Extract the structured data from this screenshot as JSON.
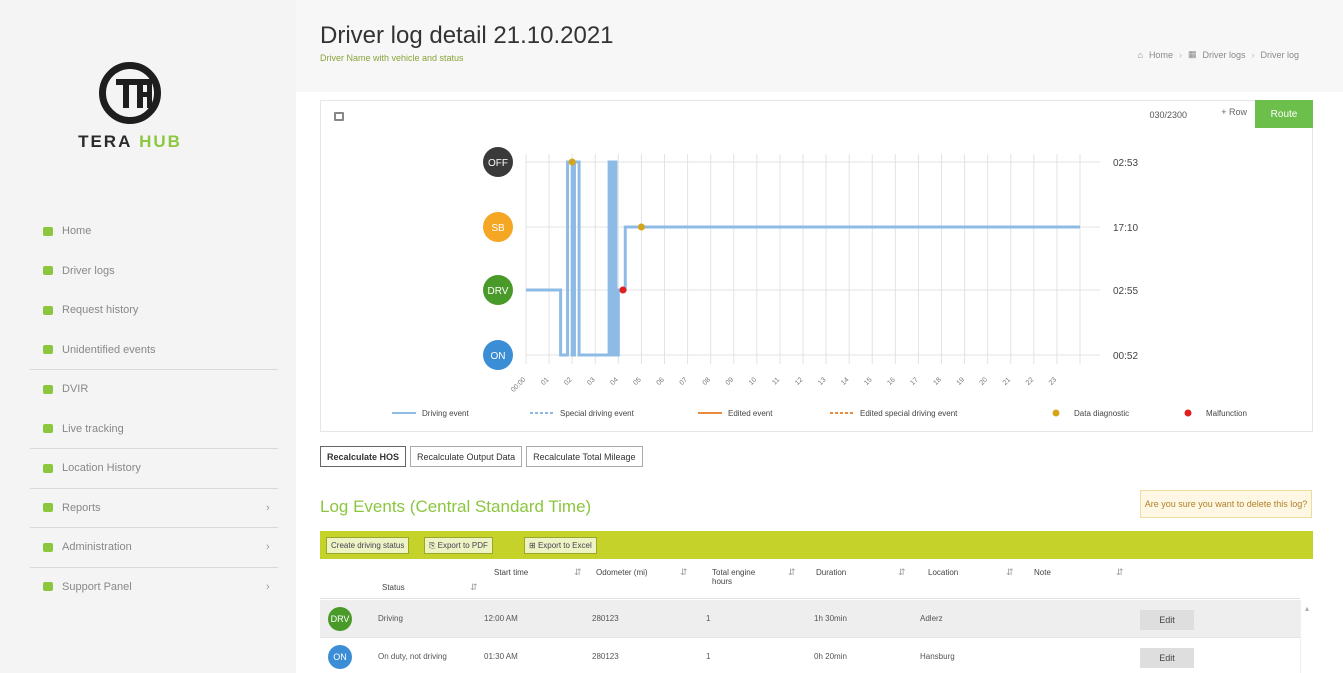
{
  "brand": {
    "part1": "TERA",
    "part2": "HUB"
  },
  "sidebar": {
    "items": [
      {
        "label": "Home",
        "icon": "home-icon",
        "color": "#8cc63f",
        "chevron": ""
      },
      {
        "label": "Driver logs",
        "icon": "edit-icon",
        "color": "#8cc63f",
        "chevron": ""
      },
      {
        "label": "Request history",
        "icon": "history-icon",
        "color": "#8cc63f",
        "chevron": ""
      },
      {
        "label": "Unidentified events",
        "icon": "user-icon",
        "color": "#8cc63f",
        "chevron": ""
      },
      {
        "label": "DVIR",
        "icon": "wrench-icon",
        "color": "#8cc63f",
        "chevron": ""
      },
      {
        "label": "Live tracking",
        "icon": "eye-icon",
        "color": "#8cc63f",
        "chevron": ""
      },
      {
        "label": "Location History",
        "icon": "map-icon",
        "color": "#8cc63f",
        "chevron": ""
      },
      {
        "label": "Reports",
        "icon": "chart-icon",
        "color": "#8cc63f",
        "chevron": "›"
      },
      {
        "label": "Administration",
        "icon": "admin-icon",
        "color": "#8cc63f",
        "chevron": "›"
      },
      {
        "label": "Support Panel",
        "icon": "support-icon",
        "color": "#8cc63f",
        "chevron": "›"
      }
    ]
  },
  "header": {
    "title": "Driver log detail 21.10.2021",
    "subtitle": "Driver Name with vehicle and status",
    "breadcrumb": [
      "Home",
      "Driver logs",
      "Driver log"
    ]
  },
  "chart_panel": {
    "counter": "030/2300",
    "plus_label": "+ Row",
    "action_label": "Route"
  },
  "chart_data": {
    "type": "line",
    "status_labels": [
      "OFF",
      "SB",
      "DRV",
      "ON"
    ],
    "status_colors": [
      "#3a3a3a",
      "#f5a623",
      "#4a9a2a",
      "#3b8ed6"
    ],
    "totals": [
      "02:53",
      "17:10",
      "02:55",
      "00:52"
    ],
    "x_ticks": [
      "00:00",
      "01",
      "02",
      "03",
      "04",
      "05",
      "06",
      "07",
      "08",
      "09",
      "10",
      "11",
      "12",
      "13",
      "14",
      "15",
      "16",
      "17",
      "18",
      "19",
      "20",
      "21",
      "22",
      "23"
    ],
    "legend": [
      {
        "label": "Driving event",
        "style": "solid",
        "color": "#8ebbe6"
      },
      {
        "label": "Special driving event",
        "style": "dashed",
        "color": "#8ebbe6"
      },
      {
        "label": "Edited event",
        "style": "solid",
        "color": "#e98a3c"
      },
      {
        "label": "Edited special driving event",
        "style": "dashed",
        "color": "#e98a3c"
      },
      {
        "label": "Data diagnostic",
        "style": "dot",
        "color": "#d4a51a"
      },
      {
        "label": "Malfunction",
        "style": "dot",
        "color": "#e02020"
      }
    ],
    "segments": [
      {
        "from": 0.0,
        "to": 1.5,
        "status": 2
      },
      {
        "from": 1.5,
        "to": 1.8,
        "status": 3
      },
      {
        "from": 1.8,
        "to": 2.0,
        "status": 0
      },
      {
        "from": 2.0,
        "to": 2.1,
        "status": 3
      },
      {
        "from": 2.1,
        "to": 2.3,
        "status": 0
      },
      {
        "from": 2.3,
        "to": 3.6,
        "status": 3
      },
      {
        "from": 3.6,
        "to": 3.7,
        "status": 0
      },
      {
        "from": 3.7,
        "to": 3.8,
        "status": 3
      },
      {
        "from": 3.8,
        "to": 3.9,
        "status": 0
      },
      {
        "from": 3.9,
        "to": 4.0,
        "status": 3
      },
      {
        "from": 4.0,
        "to": 4.3,
        "status": 2
      },
      {
        "from": 4.3,
        "to": 24.0,
        "status": 1
      }
    ],
    "markers": [
      {
        "hour": 2.0,
        "status": 0,
        "kind": "data diagnostic",
        "color": "#d4a51a"
      },
      {
        "hour": 5.0,
        "status": 1,
        "kind": "data diagnostic",
        "color": "#d4a51a"
      },
      {
        "hour": 4.2,
        "status": 2,
        "kind": "malfunction",
        "color": "#e02020"
      }
    ]
  },
  "tabs": [
    "Recalculate HOS",
    "Recalculate Output Data",
    "Recalculate Total Mileage"
  ],
  "log": {
    "title": "Log Events (Central Standard Time)",
    "notice": "Are you sure you want to delete this log?",
    "toolbar": [
      "Create driving status",
      "Export to PDF",
      "Export to Excel"
    ],
    "columns": [
      "Status",
      "Start time",
      "Odometer (mi)",
      "Total engine hours",
      "Duration",
      "Location",
      "Note"
    ],
    "rows": [
      {
        "badge": "DRV",
        "badge_color": "#4a9a2a",
        "status": "Driving",
        "start": "12:00 AM",
        "odometer": "280123",
        "engine": "1",
        "duration": "1h 30min",
        "location": "Adlerz",
        "note": "",
        "action": "Edit"
      },
      {
        "badge": "ON",
        "badge_color": "#3b8ed6",
        "status": "On duty, not driving",
        "start": "01:30 AM",
        "odometer": "280123",
        "engine": "1",
        "duration": "0h 20min",
        "location": "Hansburg",
        "note": "",
        "action": "Edit"
      }
    ]
  }
}
